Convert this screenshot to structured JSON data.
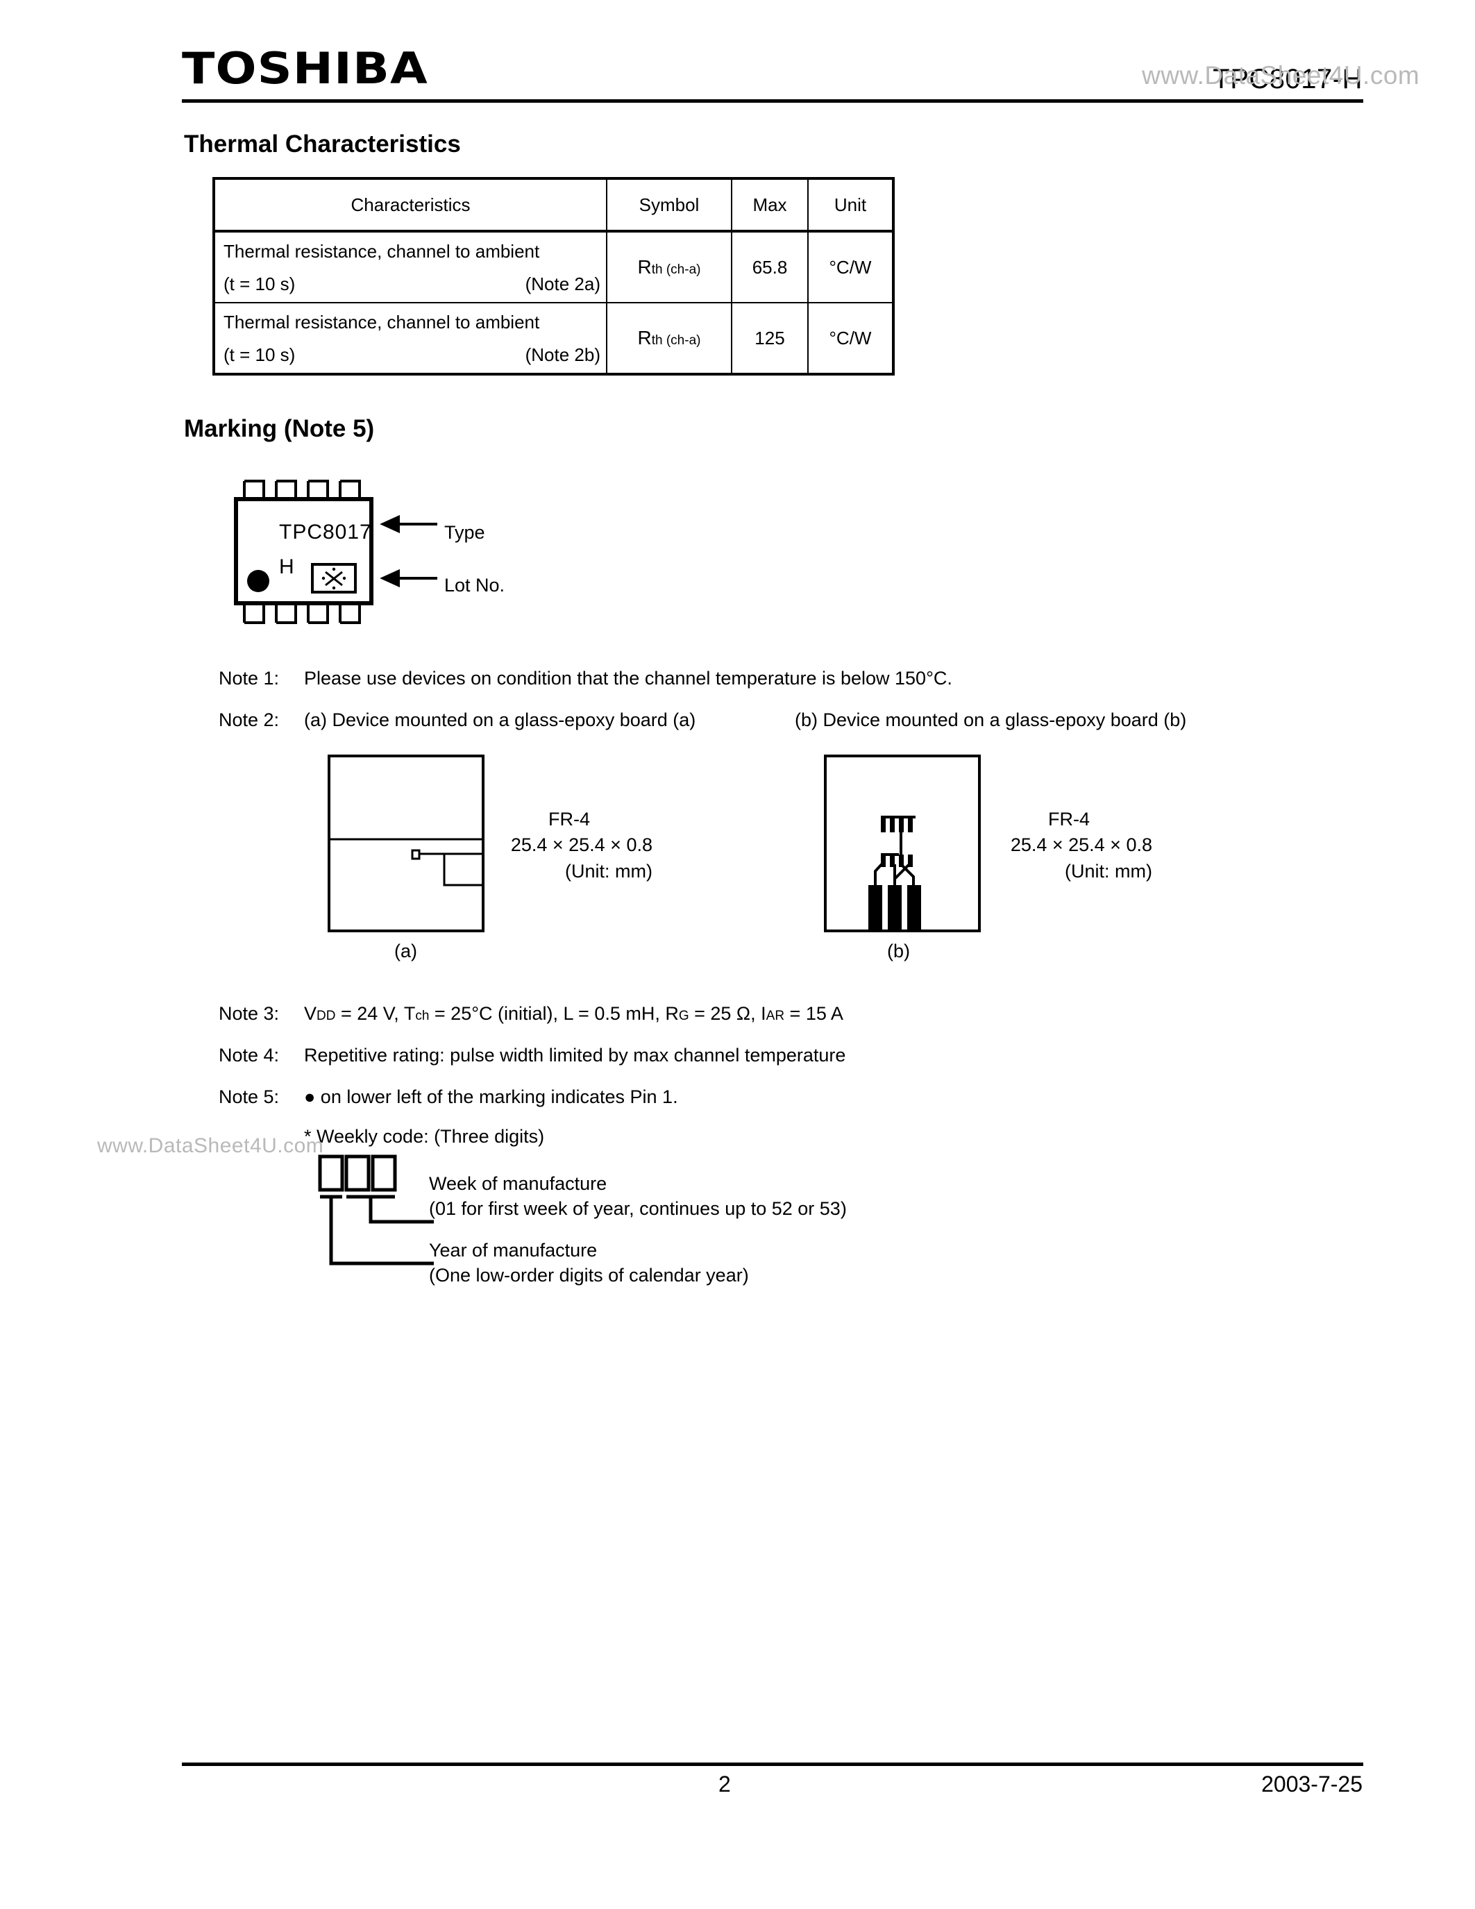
{
  "header": {
    "logo": "TOSHIBA",
    "part_number": "TPC8017-H",
    "watermark": "www.DataSheet4U.com"
  },
  "watermark_left": "www.DataSheet4U.com",
  "thermal": {
    "title": "Thermal Characteristics",
    "columns": [
      "Characteristics",
      "Symbol",
      "Max",
      "Unit"
    ],
    "rows": [
      {
        "characteristic_line1": "Thermal resistance, channel to ambient",
        "characteristic_line2": "(t = 10 s)",
        "note_ref": "(Note 2a)",
        "symbol_main": "R",
        "symbol_sub": "th (ch-a)",
        "max": "65.8",
        "unit": "°C/W"
      },
      {
        "characteristic_line1": "Thermal resistance, channel to ambient",
        "characteristic_line2": "(t = 10 s)",
        "note_ref": "(Note 2b)",
        "symbol_main": "R",
        "symbol_sub": "th (ch-a)",
        "max": "125",
        "unit": "°C/W"
      }
    ]
  },
  "marking": {
    "title": "Marking (Note 5)",
    "type_text": "TPC8017",
    "suffix_text": "H",
    "lot_symbol": "※",
    "type_label": "Type",
    "lot_label": "Lot No."
  },
  "notes": {
    "note1_label": "Note 1:",
    "note1_text": "Please use devices on condition that the channel temperature is below 150°C.",
    "note2_label": "Note 2:",
    "note2a_text": "(a) Device mounted on a glass-epoxy board (a)",
    "note2b_text": "(b) Device mounted on a glass-epoxy board (b)",
    "note3_label": "Note 3:",
    "note4_label": "Note 4:",
    "note4_text": "Repetitive rating: pulse width limited by max channel temperature",
    "note5_label": "Note 5:",
    "note5_text": "● on lower left of the marking indicates Pin 1.",
    "weekly_code_text": "* Weekly code:  (Three digits)"
  },
  "note3_params": {
    "vdd_main": "V",
    "vdd_sub": "DD",
    "vdd_val": " = 24 V, ",
    "tch_main": "T",
    "tch_sub": "ch",
    "tch_val": " = 25°C (initial), ",
    "l_val": "L = 0.5 mH, ",
    "rg_main": "R",
    "rg_sub": "G",
    "rg_val": " = 25 Ω, ",
    "iar_main": "I",
    "iar_sub": "AR",
    "iar_val": " = 15 A"
  },
  "boards": {
    "a": {
      "caption": "(a)",
      "material": "FR-4",
      "dimensions": "25.4 × 25.4 × 0.8",
      "unit_note": "(Unit: mm)"
    },
    "b": {
      "caption": "(b)",
      "material": "FR-4",
      "dimensions": "25.4 × 25.4 × 0.8",
      "unit_note": "(Unit: mm)"
    }
  },
  "weekly_code": {
    "week_label": "Week of manufacture",
    "week_detail": "(01 for first week of year, continues up to 52 or 53)",
    "year_label": "Year of manufacture",
    "year_detail": "(One low-order digits of calendar year)"
  },
  "footer": {
    "page_number": "2",
    "date": "2003-7-25"
  }
}
